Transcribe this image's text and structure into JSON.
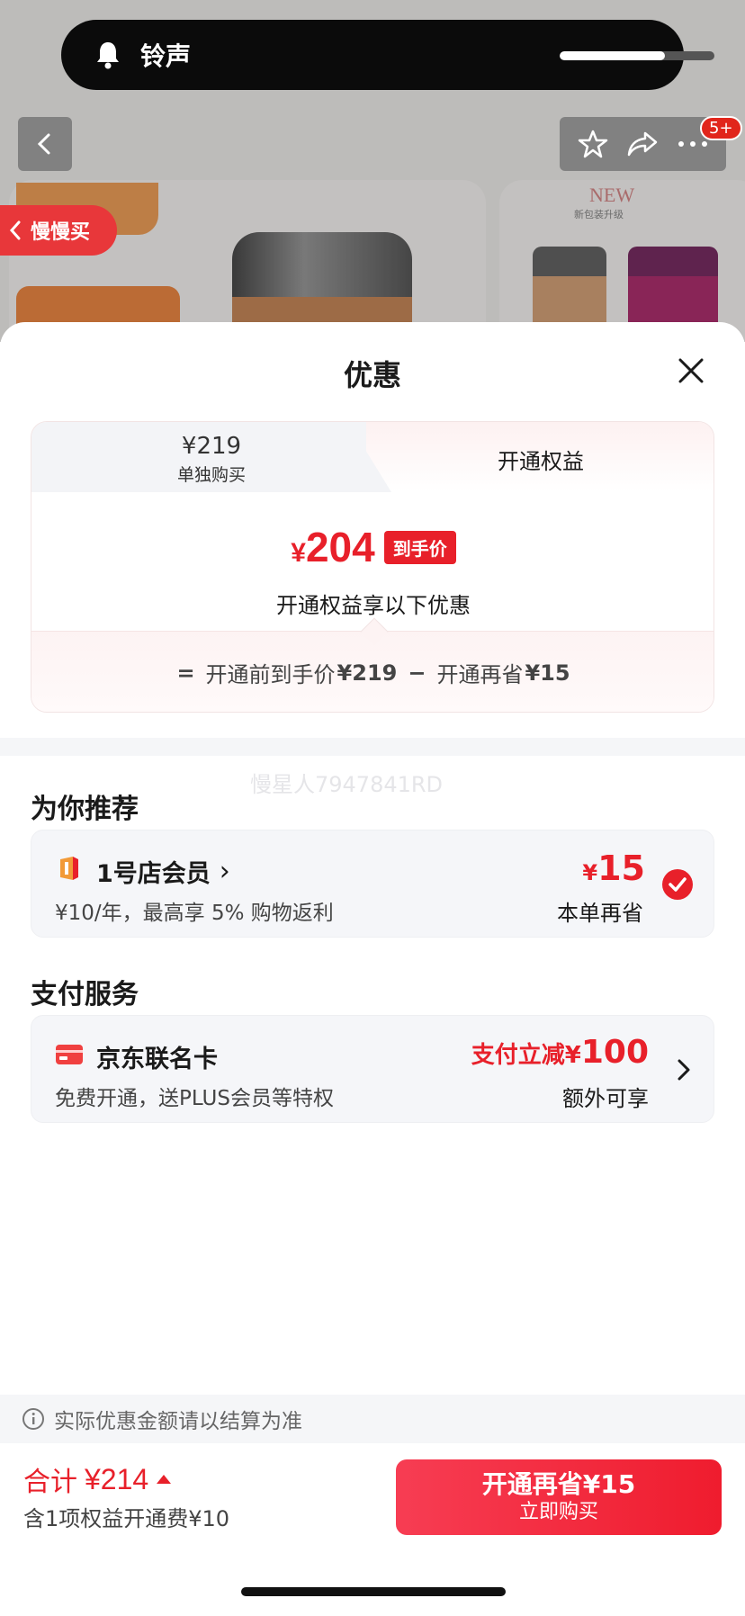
{
  "notification": {
    "label": "铃声",
    "volume_level": 0.68
  },
  "background_page": {
    "back_icon": "chevron-left-icon",
    "action_icons": [
      "star-icon",
      "share-icon",
      "more-icon"
    ],
    "badge_count": "5+",
    "slow_buy_label": "慢慢买",
    "new_label": "NEW",
    "new_sub": "新包装升级"
  },
  "sheet": {
    "title": "优惠",
    "close_icon": "close-icon"
  },
  "price_card": {
    "tab_left_price": "¥219",
    "tab_left_label": "单独购买",
    "tab_right_label": "开通权益",
    "final_yen": "¥",
    "final_amount": "204",
    "final_badge": "到手价",
    "final_sub": "开通权益享以下优惠",
    "formula": {
      "equals": "=",
      "before_label": "开通前到手价",
      "before_price": "¥219",
      "minus": "−",
      "save_label": "开通再省",
      "save_price": "¥15"
    }
  },
  "watermark": "慢星人7947841RD",
  "recommend": {
    "title": "为你推荐",
    "item": {
      "icon": "store-flag-icon",
      "name": "1号店会员",
      "chevron": "›",
      "desc": "¥10/年，最高享 5% 购物返利",
      "amount_yen": "¥",
      "amount": "15",
      "note": "本单再省",
      "selected": true
    }
  },
  "payment": {
    "title": "支付服务",
    "item": {
      "icon": "credit-card-icon",
      "name": "京东联名卡",
      "desc": "免费开通，送PLUS会员等特权",
      "discount_prefix": "支付立减¥",
      "discount_amount": "100",
      "note": "额外可享"
    }
  },
  "footer": {
    "notice": "实际优惠金额请以结算为准",
    "total_label": "合计",
    "total_amount": "¥214",
    "fee_text": "含1项权益开通费¥10",
    "button_main": "开通再省¥15",
    "button_sub": "立即购买"
  },
  "colors": {
    "accent_red": "#e8202a",
    "button_red": "#ef1c2e"
  }
}
